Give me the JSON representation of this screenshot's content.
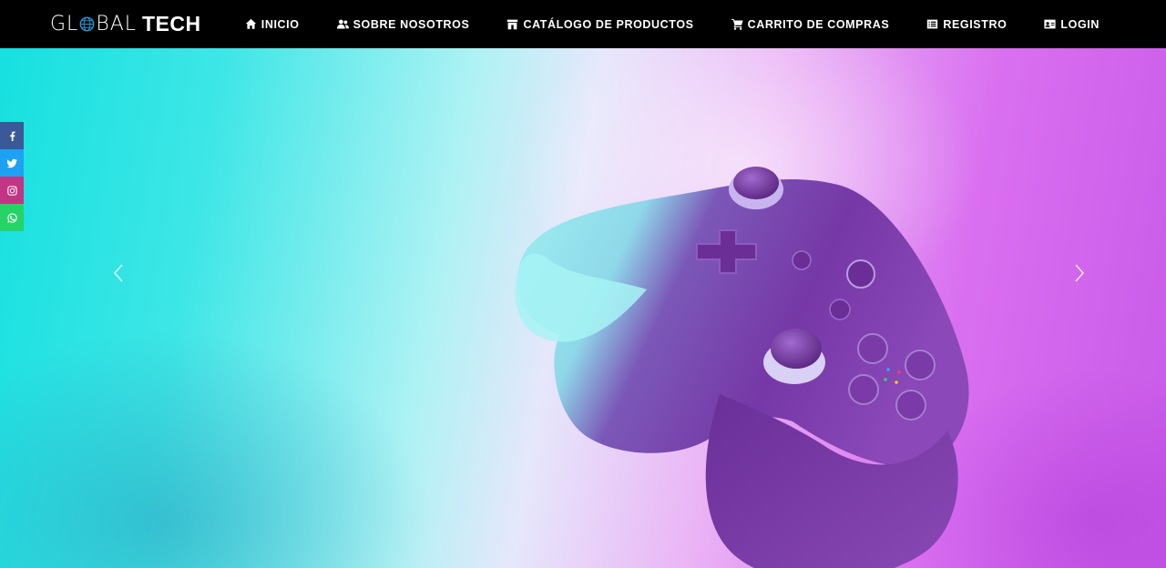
{
  "brand": {
    "part1": "GL",
    "part2": "BAL",
    "part3": "TECH"
  },
  "nav": {
    "items": [
      {
        "label": "INICIO",
        "icon": "home-icon"
      },
      {
        "label": "SOBRE NOSOTROS",
        "icon": "users-icon"
      },
      {
        "label": "CATÁLOGO DE PRODUCTOS",
        "icon": "store-icon"
      },
      {
        "label": "CARRITO DE COMPRAS",
        "icon": "cart-icon"
      },
      {
        "label": "REGISTRO",
        "icon": "list-icon"
      },
      {
        "label": "LOGIN",
        "icon": "id-card-icon"
      }
    ]
  },
  "social": [
    {
      "name": "facebook-icon",
      "color": "#3b5998"
    },
    {
      "name": "twitter-icon",
      "color": "#1da1f2"
    },
    {
      "name": "instagram-icon",
      "color": "#c13584"
    },
    {
      "name": "whatsapp-icon",
      "color": "#25d366"
    }
  ],
  "hero": {
    "image": "game-controller-photo",
    "colors": {
      "left": "#17e0e0",
      "right": "#c85ae8",
      "controller": "#7a3aa8"
    }
  },
  "carousel": {
    "prev": "chevron-left-icon",
    "next": "chevron-right-icon"
  }
}
